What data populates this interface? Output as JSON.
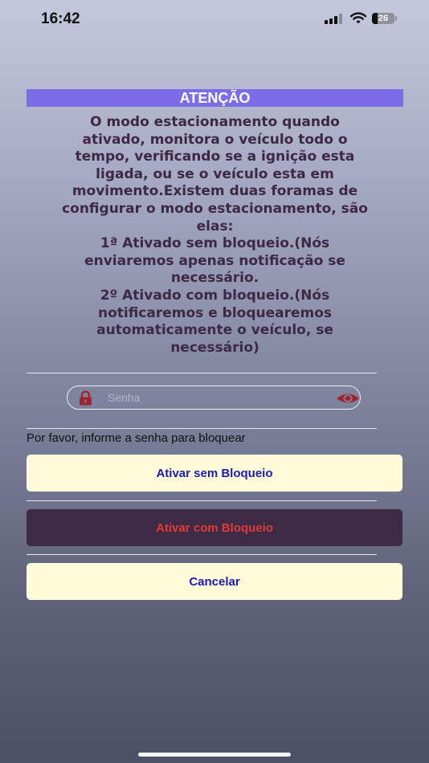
{
  "status_bar": {
    "time": "16:42",
    "battery_level": "26",
    "battery_fraction": 0.26
  },
  "dialog": {
    "title": "ATENÇÃO",
    "body_lines": [
      "O modo estacionamento quando",
      "ativado, monitora o veículo todo o",
      "tempo, verificando se a ignição esta",
      "ligada, ou se o veículo esta em",
      "movimento.Existem duas foramas de",
      "configurar o modo estacionamento, são",
      "elas:",
      "1ª Ativado sem bloqueio.(Nós",
      "enviaremos apenas notificação se",
      "necessário.",
      "2º Ativado com bloqueio.(Nós",
      "notificaremos e bloquearemos",
      "automaticamente o veículo, se",
      "necessário)"
    ]
  },
  "password": {
    "placeholder": "Senha",
    "value": "",
    "lock_icon": "lock-icon",
    "toggle_icon": "eye-icon"
  },
  "instruction": "Por favor, informe a senha para bloquear",
  "buttons": {
    "activate_without_lock": "Ativar sem Bloqueio",
    "activate_with_lock": "Ativar com Bloqueio",
    "cancel": "Cancelar"
  },
  "colors": {
    "header_bg": "#7d6ce8",
    "body_text": "#3d2846",
    "light_button_bg": "#fffbd8",
    "light_button_text": "#1a1ab8",
    "dark_button_bg": "#3d2a44",
    "dark_button_text": "#e23a36",
    "icon_red": "#a3232d"
  }
}
